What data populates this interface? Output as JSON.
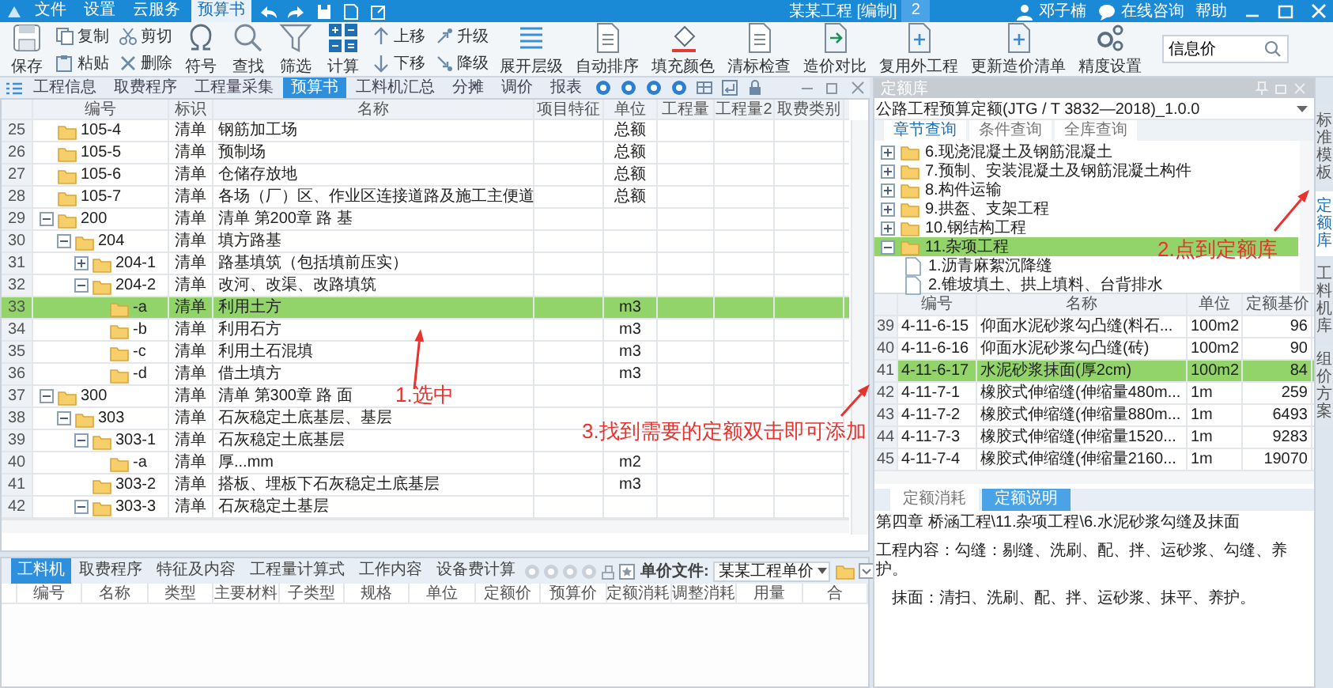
{
  "titlebar": {
    "menus": [
      {
        "label": "文件",
        "selected": false
      },
      {
        "label": "设置",
        "selected": false
      },
      {
        "label": "云服务",
        "selected": false
      },
      {
        "label": "预算书",
        "selected": true
      }
    ],
    "title": "某某工程 [编制]",
    "badge": "2",
    "user": "邓子楠",
    "consult": "在线咨询",
    "help": "帮助"
  },
  "ribbon": {
    "groups": [
      {
        "kind": "large",
        "label": "保存"
      },
      {
        "kind": "pair",
        "items": [
          "复制",
          "粘贴"
        ]
      },
      {
        "kind": "pair",
        "items": [
          "剪切",
          "删除"
        ]
      },
      {
        "kind": "large",
        "label": "符号"
      },
      {
        "kind": "large",
        "label": "查找"
      },
      {
        "kind": "large",
        "label": "筛选"
      },
      {
        "kind": "large",
        "label": "计算"
      },
      {
        "kind": "pair",
        "items": [
          "上移",
          "下移"
        ]
      },
      {
        "kind": "pair",
        "items": [
          "升级",
          "降级"
        ]
      },
      {
        "kind": "large",
        "label": "展开层级"
      },
      {
        "kind": "large",
        "label": "自动排序"
      },
      {
        "kind": "large",
        "label": "填充颜色"
      },
      {
        "kind": "large",
        "label": "清标检查"
      },
      {
        "kind": "large",
        "label": "造价对比"
      },
      {
        "kind": "large",
        "label": "复用外工程"
      },
      {
        "kind": "large",
        "label": "更新造价清单"
      },
      {
        "kind": "large",
        "label": "精度设置"
      }
    ],
    "search": {
      "value": "信息价"
    }
  },
  "view_tabs": [
    {
      "label": "工程信息",
      "selected": false
    },
    {
      "label": "取费程序",
      "selected": false
    },
    {
      "label": "工程量采集",
      "selected": false
    },
    {
      "label": "预算书",
      "selected": true
    },
    {
      "label": "工料机汇总",
      "selected": false
    },
    {
      "label": "分摊",
      "selected": false
    },
    {
      "label": "调价",
      "selected": false
    },
    {
      "label": "报表",
      "selected": false
    }
  ],
  "budget_table": {
    "columns": [
      "编号",
      "标识",
      "名称",
      "项目特征",
      "单位",
      "工程量",
      "工程量2",
      "取费类别"
    ],
    "rows": [
      {
        "num": "25",
        "code": "105-4",
        "mark": "清单",
        "name": "钢筋加工场",
        "unit": "总额",
        "selected": false
      },
      {
        "num": "26",
        "code": "105-5",
        "mark": "清单",
        "name": "预制场",
        "unit": "总额",
        "selected": false
      },
      {
        "num": "27",
        "code": "105-6",
        "mark": "清单",
        "name": "仓储存放地",
        "unit": "总额",
        "selected": false
      },
      {
        "num": "28",
        "code": "105-7",
        "mark": "清单",
        "name": "各场（厂）区、作业区连接道路及施工主便道",
        "unit": "总额",
        "selected": false
      },
      {
        "num": "29",
        "code": "200",
        "mark": "清单",
        "name": "清单 第200章 路 基",
        "selected": false,
        "expanded": true,
        "children": [
          {
            "num": "30",
            "code": "204",
            "mark": "清单",
            "name": "填方路基",
            "selected": false,
            "expanded": true,
            "children": [
              {
                "num": "31",
                "code": "204-1",
                "mark": "清单",
                "name": "路基填筑（包括填前压实）",
                "selected": false,
                "expanded": false
              },
              {
                "num": "32",
                "code": "204-2",
                "mark": "清单",
                "name": "改河、改渠、改路填筑",
                "selected": false,
                "expanded": true,
                "children": [
                  {
                    "num": "33",
                    "code": "-a",
                    "mark": "清单",
                    "name": "利用土方",
                    "unit": "m3",
                    "selected": true
                  },
                  {
                    "num": "34",
                    "code": "-b",
                    "mark": "清单",
                    "name": "利用石方",
                    "unit": "m3",
                    "selected": false
                  },
                  {
                    "num": "35",
                    "code": "-c",
                    "mark": "清单",
                    "name": "利用土石混填",
                    "unit": "m3",
                    "selected": false
                  },
                  {
                    "num": "36",
                    "code": "-d",
                    "mark": "清单",
                    "name": "借土填方",
                    "unit": "m3",
                    "selected": false
                  }
                ]
              }
            ]
          }
        ]
      },
      {
        "num": "37",
        "code": "300",
        "mark": "清单",
        "name": "清单 第300章 路 面",
        "selected": false,
        "expanded": true,
        "children": [
          {
            "num": "38",
            "code": "303",
            "mark": "清单",
            "name": "石灰稳定土底基层、基层",
            "selected": false,
            "expanded": true,
            "children": [
              {
                "num": "39",
                "code": "303-1",
                "mark": "清单",
                "name": "石灰稳定土底基层",
                "selected": false,
                "expanded": true,
                "children": [
                  {
                    "num": "40",
                    "code": "-a",
                    "mark": "清单",
                    "name": "厚...mm",
                    "unit": "m2",
                    "selected": false
                  }
                ]
              },
              {
                "num": "41",
                "code": "303-2",
                "mark": "清单",
                "name": "搭板、埋板下石灰稳定土底基层",
                "unit": "m3",
                "selected": false
              },
              {
                "num": "42",
                "code": "303-3",
                "mark": "清单",
                "name": "石灰稳定土基层",
                "selected": false,
                "expanded": true
              }
            ]
          }
        ]
      }
    ]
  },
  "detail_panel": {
    "tabs": [
      {
        "label": "工料机",
        "selected": true
      },
      {
        "label": "取费程序",
        "selected": false
      },
      {
        "label": "特征及内容",
        "selected": false
      },
      {
        "label": "工程量计算式",
        "selected": false
      },
      {
        "label": "工作内容",
        "selected": false
      },
      {
        "label": "设备费计算",
        "selected": false
      }
    ],
    "price_file_label": "单价文件:",
    "price_file": "某某工程单价",
    "columns": [
      "编号",
      "名称",
      "类型",
      "主要材料",
      "子类型",
      "规格",
      "单位",
      "定额价",
      "预算价",
      "定额消耗",
      "调整消耗",
      "用量",
      "合"
    ]
  },
  "quota_panel": {
    "title": "定额库",
    "library": "公路工程预算定额(JTG / T 3832—2018)_1.0.0",
    "tabs": [
      {
        "label": "章节查询",
        "selected": true
      },
      {
        "label": "条件查询",
        "selected": false
      },
      {
        "label": "全库查询",
        "selected": false
      }
    ],
    "tree": [
      {
        "label": "6.现浇混凝土及钢筋混凝土",
        "expanded": false,
        "selected": false
      },
      {
        "label": "7.预制、安装混凝土及钢筋混凝土构件",
        "expanded": false,
        "selected": false
      },
      {
        "label": "8.构件运输",
        "expanded": false,
        "selected": false
      },
      {
        "label": "9.拱盔、支架工程",
        "expanded": false,
        "selected": false
      },
      {
        "label": "10.钢结构工程",
        "expanded": false,
        "selected": false
      },
      {
        "label": "11.杂项工程",
        "expanded": true,
        "selected": true,
        "children": [
          {
            "label": "1.沥青麻絮沉降缝",
            "selected": false
          },
          {
            "label": "2.锥坡填土、拱上填料、台背排水",
            "selected": false
          }
        ]
      }
    ],
    "columns": [
      "编号",
      "名称",
      "单位",
      "定额基价"
    ],
    "rows": [
      {
        "num": "39",
        "code": "4-11-6-15",
        "name": "仰面水泥砂浆勾凸缝(料石...",
        "unit": "100m2",
        "price": "96",
        "selected": false
      },
      {
        "num": "40",
        "code": "4-11-6-16",
        "name": "仰面水泥砂浆勾凸缝(砖)",
        "unit": "100m2",
        "price": "90",
        "selected": false
      },
      {
        "num": "41",
        "code": "4-11-6-17",
        "name": "水泥砂浆抹面(厚2cm)",
        "unit": "100m2",
        "price": "84",
        "selected": true
      },
      {
        "num": "42",
        "code": "4-11-7-1",
        "name": "橡胶式伸缩缝(伸缩量480m...",
        "unit": "1m",
        "price": "259",
        "selected": false
      },
      {
        "num": "43",
        "code": "4-11-7-2",
        "name": "橡胶式伸缩缝(伸缩量880m...",
        "unit": "1m",
        "price": "6493",
        "selected": false
      },
      {
        "num": "44",
        "code": "4-11-7-3",
        "name": "橡胶式伸缩缝(伸缩量1520...",
        "unit": "1m",
        "price": "9283",
        "selected": false
      },
      {
        "num": "45",
        "code": "4-11-7-4",
        "name": "橡胶式伸缩缝(伸缩量2160...",
        "unit": "1m",
        "price": "19070",
        "selected": false
      }
    ],
    "bottom_tabs": [
      {
        "label": "定额消耗",
        "selected": false
      },
      {
        "label": "定额说明",
        "selected": true
      }
    ],
    "path": "第四章 桥涵工程\\11.杂项工程\\6.水泥砂浆勾缝及抹面",
    "lines": [
      {
        "text": "工程内容：勾缝：剔缝、洗刷、配、拌、运砂浆、勾缝、养护。",
        "indent": false
      },
      {
        "text": "抹面：清扫、洗刷、配、拌、运砂浆、抹平、养护。",
        "indent": true
      }
    ]
  },
  "side_tabs": [
    {
      "label": "标准模板",
      "selected": false
    },
    {
      "label": "定额库",
      "selected": true
    },
    {
      "label": "工料机库",
      "selected": false
    },
    {
      "label": "组价方案",
      "selected": false
    }
  ],
  "annotations": [
    {
      "text": "1.选中"
    },
    {
      "text": "2.点到定额库"
    },
    {
      "text": "3.找到需要的定额双击即可添加"
    }
  ]
}
